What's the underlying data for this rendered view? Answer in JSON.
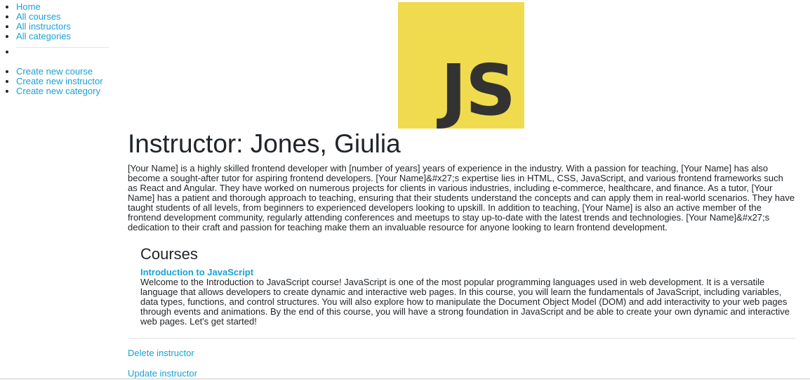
{
  "sidebar": {
    "nav": [
      {
        "label": "Home"
      },
      {
        "label": "All courses"
      },
      {
        "label": "All instructors"
      },
      {
        "label": "All categories"
      }
    ],
    "create": [
      {
        "label": "Create new course"
      },
      {
        "label": "Create new instructor"
      },
      {
        "label": "Create new category"
      }
    ]
  },
  "logo": {
    "text": "JS",
    "bg_color": "#f0db4f",
    "fg_color": "#323330"
  },
  "instructor": {
    "title": "Instructor: Jones, Giulia",
    "bio": "[Your Name] is a highly skilled frontend developer with [number of years] years of experience in the industry. With a passion for teaching, [Your Name] has also become a sought-after tutor for aspiring frontend developers. [Your Name]&#x27;s expertise lies in HTML, CSS, JavaScript, and various frontend frameworks such as React and Angular. They have worked on numerous projects for clients in various industries, including e-commerce, healthcare, and finance. As a tutor, [Your Name] has a patient and thorough approach to teaching, ensuring that their students understand the concepts and can apply them in real-world scenarios. They have taught students of all levels, from beginners to experienced developers looking to upskill. In addition to teaching, [Your Name] is also an active member of the frontend development community, regularly attending conferences and meetups to stay up-to-date with the latest trends and technologies. [Your Name]&#x27;s dedication to their craft and passion for teaching make them an invaluable resource for anyone looking to learn frontend development."
  },
  "courses": {
    "heading": "Courses",
    "items": [
      {
        "name": "Introduction to JavaScript",
        "description": "Welcome to the Introduction to JavaScript course! JavaScript is one of the most popular programming languages used in web development. It is a versatile language that allows developers to create dynamic and interactive web pages. In this course, you will learn the fundamentals of JavaScript, including variables, data types, functions, and control structures. You will also explore how to manipulate the Document Object Model (DOM) and add interactivity to your web pages through events and animations. By the end of this course, you will have a strong foundation in JavaScript and be able to create your own dynamic and interactive web pages. Let's get started!"
      }
    ]
  },
  "actions": {
    "delete_label": "Delete instructor",
    "update_label": "Update instructor"
  },
  "colors": {
    "link": "#17a2d6",
    "text": "#212529",
    "divider": "#e3e3e3"
  }
}
